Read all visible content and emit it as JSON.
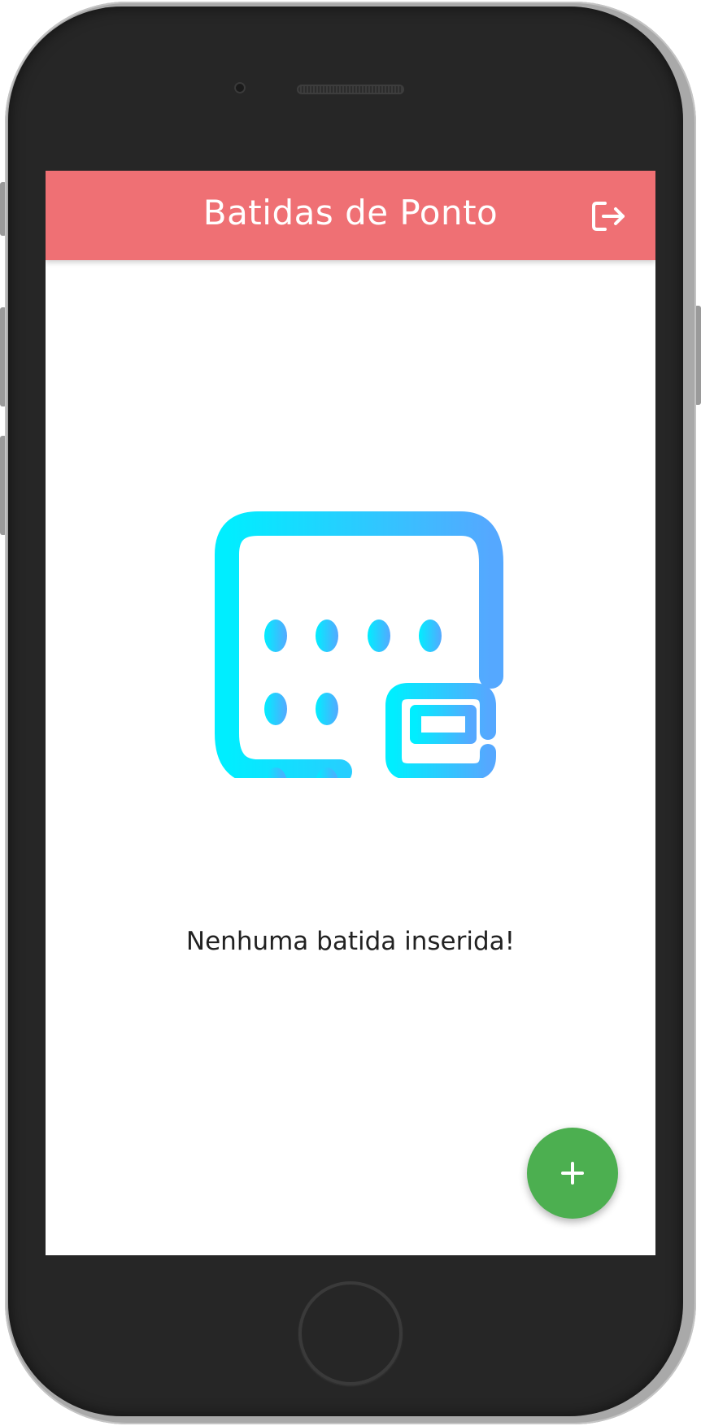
{
  "app": {
    "header_title": "Batidas de Ponto",
    "header_color": "#ef7074",
    "logout_icon": "logout-icon"
  },
  "main": {
    "illustration_icon": "calendar-calculator-icon",
    "empty_message": "Nenhuma batida inserida!",
    "gradient_colors": [
      "#00eeff",
      "#55a8ff"
    ]
  },
  "fab": {
    "icon": "plus-icon",
    "color": "#4caf50"
  }
}
